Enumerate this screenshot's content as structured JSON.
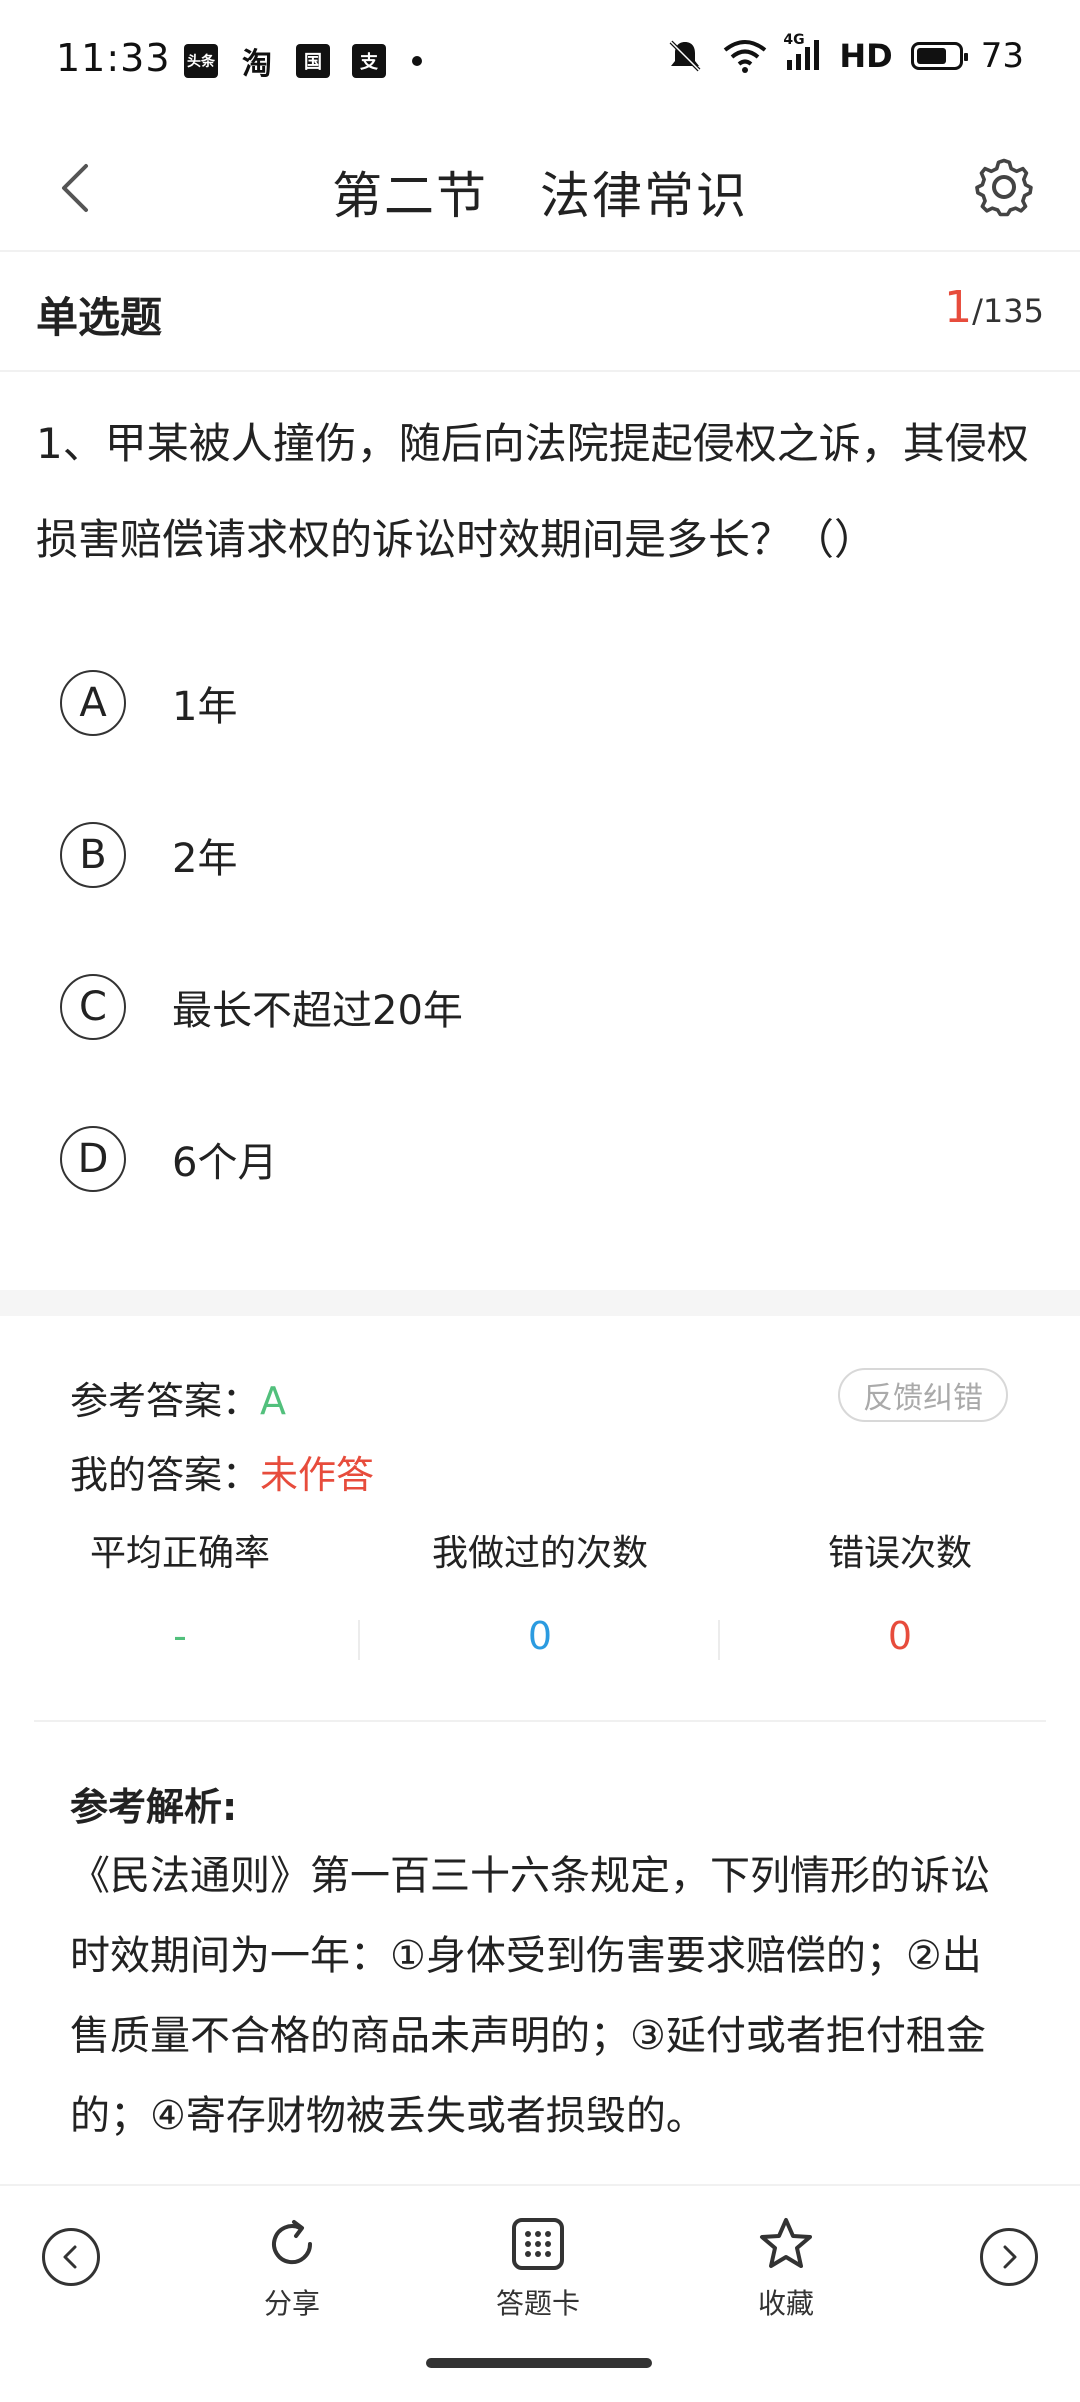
{
  "status_bar": {
    "time": "11:33",
    "apps": [
      "头条",
      "淘",
      "国",
      "支"
    ],
    "network": "4G",
    "hd": "HD",
    "battery_level": 73,
    "battery_text": "73"
  },
  "header": {
    "title": "第二节　法律常识"
  },
  "question_meta": {
    "type": "单选题",
    "current": "1",
    "total": "/135"
  },
  "question": {
    "text": "1、甲某被人撞伤，随后向法院提起侵权之诉，其侵权损害赔偿请求权的诉讼时效期间是多长？（）"
  },
  "options": [
    {
      "letter": "A",
      "text": "1年"
    },
    {
      "letter": "B",
      "text": "2年"
    },
    {
      "letter": "C",
      "text": "最长不超过20年"
    },
    {
      "letter": "D",
      "text": "6个月"
    }
  ],
  "answer": {
    "ref_label": "参考答案：",
    "ref_value": "A",
    "mine_label": "我的答案：",
    "mine_value": "未作答",
    "feedback_label": "反馈纠错"
  },
  "stats": [
    {
      "label": "平均正确率",
      "value": "-",
      "color": "#52c07c"
    },
    {
      "label": "我做过的次数",
      "value": "0",
      "color": "#2b9be0"
    },
    {
      "label": "错误次数",
      "value": "0",
      "color": "#e74c3c"
    }
  ],
  "analysis": {
    "title": "参考解析:",
    "body": "《民法通则》第一百三十六条规定，下列情形的诉讼时效期间为一年：①身体受到伤害要求赔偿的；②出售质量不合格的商品未声明的；③延付或者拒付租金的；④寄存财物被丢失或者损毁的。"
  },
  "bottom_bar": {
    "share": "分享",
    "answer_card": "答题卡",
    "favorite": "收藏"
  }
}
